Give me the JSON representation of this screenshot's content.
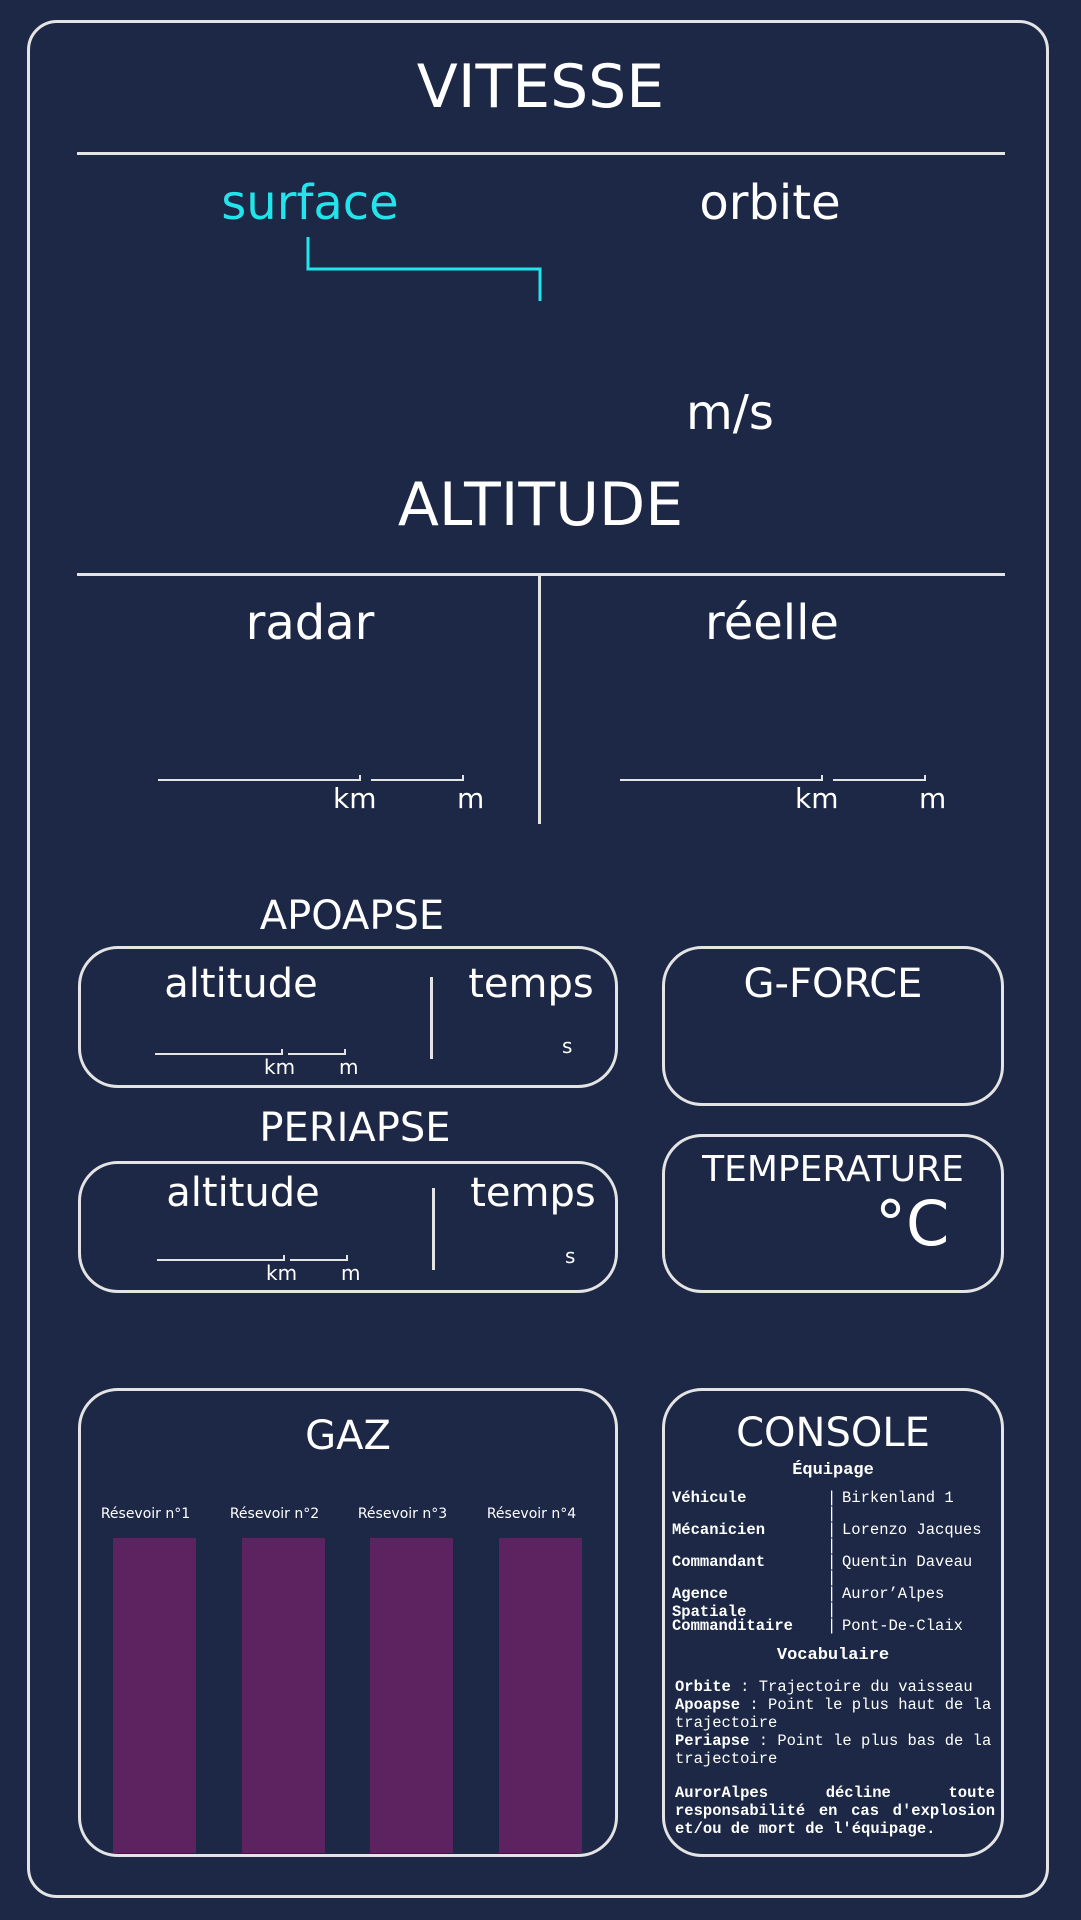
{
  "speed": {
    "title": "VITESSE",
    "tabs": [
      {
        "label": "surface",
        "active": true
      },
      {
        "label": "orbite",
        "active": false
      }
    ],
    "unit": "m/s"
  },
  "altitude": {
    "title": "ALTITUDE",
    "radar": {
      "label": "radar",
      "unit_km": "km",
      "unit_m": "m"
    },
    "real": {
      "label": "réelle",
      "unit_km": "km",
      "unit_m": "m"
    }
  },
  "apoapse": {
    "title": "APOAPSE",
    "altitude_label": "altitude",
    "time_label": "temps",
    "unit_km": "km",
    "unit_m": "m",
    "unit_s": "s"
  },
  "periapse": {
    "title": "PERIAPSE",
    "altitude_label": "altitude",
    "time_label": "temps",
    "unit_km": "km",
    "unit_m": "m",
    "unit_s": "s"
  },
  "gforce": {
    "title": "G-FORCE"
  },
  "temperature": {
    "title": "TEMPERATURE",
    "unit": "°C"
  },
  "gas": {
    "title": "GAZ",
    "tanks": [
      "Résevoir n°1",
      "Résevoir n°2",
      "Résevoir n°3",
      "Résevoir n°4"
    ]
  },
  "console": {
    "title": "CONSOLE",
    "crew_heading": "Équipage",
    "crew": [
      {
        "key": "Véhicule",
        "value": "Birkenland 1"
      },
      {
        "key": "Mécanicien",
        "value": "Lorenzo Jacques"
      },
      {
        "key": "Commandant",
        "value": "Quentin Daveau"
      },
      {
        "key": "Agence Spatiale",
        "value": "Auror’Alpes"
      },
      {
        "key": "Commanditaire",
        "value": "Pont-De-Claix"
      }
    ],
    "separator": "|",
    "vocab_heading": "Vocabulaire",
    "vocab": [
      {
        "term": "Orbite",
        "def": " : Trajectoire du vaisseau"
      },
      {
        "term": "Apoapse",
        "def": " : Point le plus haut de la trajectoire"
      },
      {
        "term": "Periapse",
        "def": " : Point le plus bas de la trajectoire"
      }
    ],
    "disclaimer": "AurorAlpes décline toute responsabilité en cas d'explosion et/ou de mort de l'équipage."
  },
  "colors": {
    "background": "#1c2845",
    "accent": "#22e5ec",
    "tank": "#5c2360",
    "line": "#e4e4e4"
  }
}
